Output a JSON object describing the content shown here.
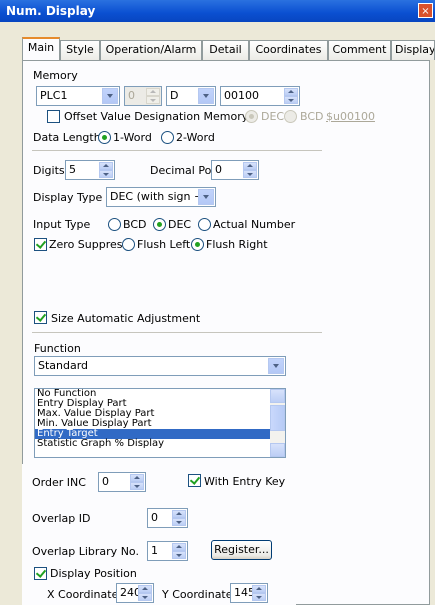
{
  "window": {
    "title": "Num. Display",
    "close_glyph": "×"
  },
  "tabs": [
    "Main",
    "Style",
    "Operation/Alarm",
    "Detail",
    "Coordinates",
    "Comment",
    "Display Setting"
  ],
  "memory": {
    "label": "Memory",
    "plc": "PLC1",
    "station": "0",
    "device": "D",
    "address": "00100",
    "offset_label": "Offset Value Designation Memory",
    "offset_dec": "DEC",
    "offset_bcd": "BCD",
    "offset_address": "$u00100"
  },
  "data_length": {
    "label": "Data Length",
    "opt1": "1-Word",
    "opt2": "2-Word"
  },
  "digits": {
    "label": "Digits",
    "value": "5"
  },
  "decimal_point": {
    "label": "Decimal Point",
    "value": "0"
  },
  "display_type": {
    "label": "Display Type",
    "value": "DEC (with sign +-)"
  },
  "input_type": {
    "label": "Input Type",
    "opt1": "BCD",
    "opt2": "DEC",
    "opt3": "Actual Number"
  },
  "zero_suppress": {
    "label": "Zero Suppress",
    "opt1": "Flush Left",
    "opt2": "Flush Right"
  },
  "size_auto": {
    "label": "Size Automatic Adjustment"
  },
  "function": {
    "label": "Function",
    "value": "Standard",
    "list": [
      "No Function",
      "Entry Display Part",
      "Max. Value Display Part",
      "Min. Value Display Part",
      "Entry Target",
      "Statistic Graph % Display"
    ],
    "selected_index": 4
  },
  "order_inc": {
    "label": "Order INC",
    "value": "0",
    "with_entry_key": "With Entry Key"
  },
  "overlap_id": {
    "label": "Overlap ID",
    "value": "0"
  },
  "overlap_lib": {
    "label": "Overlap Library No.",
    "value": "1",
    "register": "Register..."
  },
  "display_position": {
    "label": "Display Position",
    "x_label": "X Coordinate",
    "x_value": "240",
    "y_label": "Y Coordinate",
    "y_value": "145"
  },
  "colors": {
    "titlebar": "#0a4fd1",
    "selection": "#316ac5",
    "check": "#21a121",
    "tab_highlight": "#e68b2c"
  }
}
